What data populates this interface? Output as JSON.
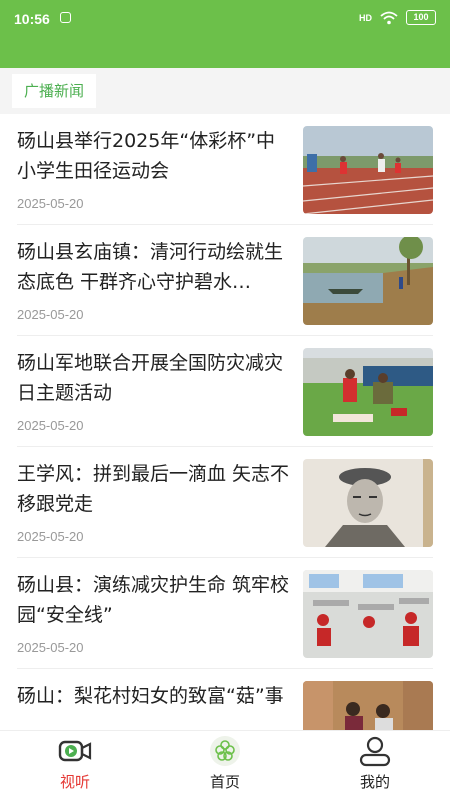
{
  "status": {
    "time": "10:56",
    "signal": "HD",
    "battery": "100"
  },
  "tabs": {
    "active": "广播新闻"
  },
  "news": [
    {
      "title": "砀山县举行2025年“体彩杯”中小学生田径运动会",
      "date": "2025-05-20",
      "image": "track-race-image"
    },
    {
      "title": "砀山县玄庙镇：清河行动绘就生态底色 干群齐心守护碧水…",
      "date": "2025-05-20",
      "image": "river-boat-image"
    },
    {
      "title": "砀山军地联合开展全国防灾减灾日主题活动",
      "date": "2025-05-20",
      "image": "first-aid-drill-image"
    },
    {
      "title": "王学风：拼到最后一滴血 矢志不移跟党走",
      "date": "2025-05-20",
      "image": "portrait-sketch-image"
    },
    {
      "title": "砀山县：演练减灾护生命 筑牢校园“安全线”",
      "date": "2025-05-20",
      "image": "classroom-drill-image"
    },
    {
      "title": "砀山：梨花村妇女的致富“菇”事",
      "date": "",
      "image": "mushroom-farm-image"
    }
  ],
  "bottom_nav": {
    "items": [
      {
        "label": "视听",
        "icon": "video-camera-icon",
        "active": true
      },
      {
        "label": "首页",
        "icon": "flower-logo-icon",
        "active": false
      },
      {
        "label": "我的",
        "icon": "user-profile-icon",
        "active": false
      }
    ]
  },
  "colors": {
    "brand_green": "#6cc04a",
    "tab_active_text": "#4caf50",
    "nav_active": "#e53935",
    "date_gray": "#999999"
  }
}
